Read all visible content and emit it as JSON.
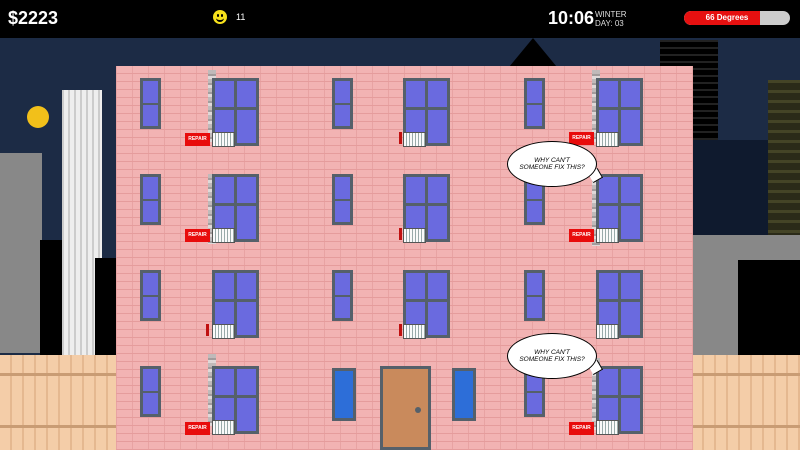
{
  "hud": {
    "money": "$2223",
    "mood_icon": "smiley-face-icon",
    "mood_count": "11",
    "time": "10:06",
    "season": "WINTER",
    "day": "DAY: 03",
    "temperature_label": "66 Degrees",
    "temperature_fill": 0.72
  },
  "repair_label": "REPAIR",
  "tenant_complaint": "WHY CAN'T SOMEONE FIX THIS?",
  "colors": {
    "brick": "#f2b3b3",
    "window_glass": "#6a6adf",
    "window_frame": "#55606a",
    "repair_button": "#e80c0c",
    "temperature_fill": "#e61010",
    "sky": "#1c2b45"
  }
}
